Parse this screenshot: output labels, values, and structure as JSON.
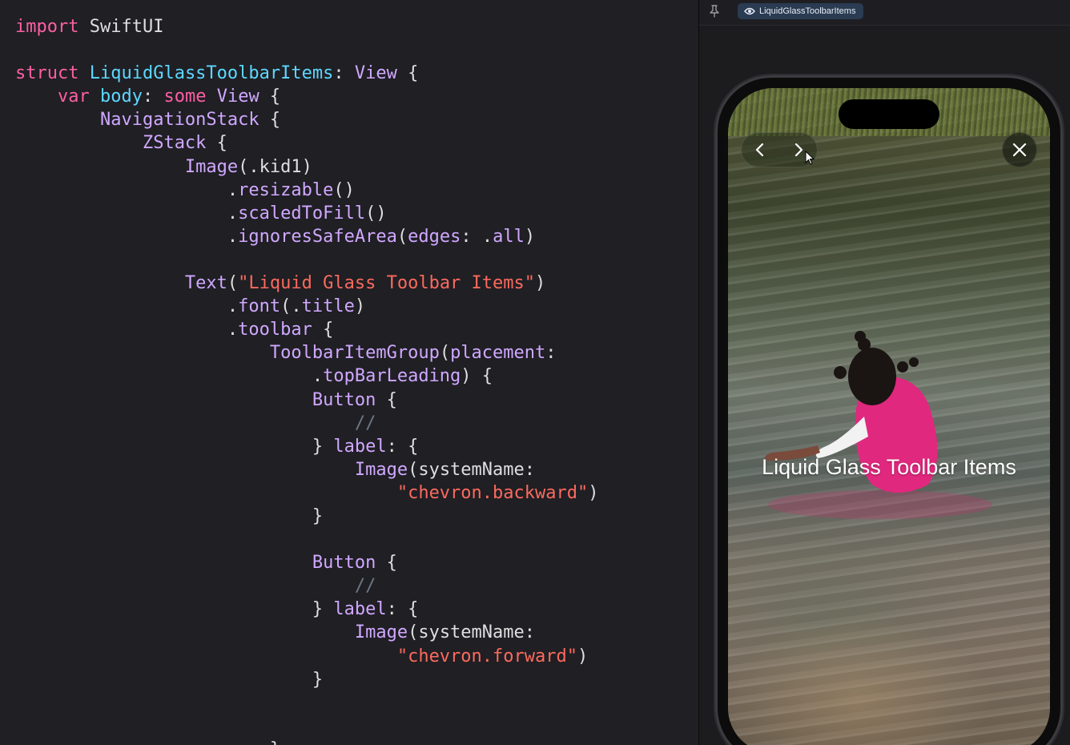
{
  "editor": {
    "lines": [
      [
        {
          "t": "import",
          "c": "kw"
        },
        {
          "t": " SwiftUI",
          "c": "pln"
        }
      ],
      [],
      [
        {
          "t": "struct",
          "c": "kw"
        },
        {
          "t": " ",
          "c": "pln"
        },
        {
          "t": "LiquidGlassToolbarItems",
          "c": "typ"
        },
        {
          "t": ": ",
          "c": "pln"
        },
        {
          "t": "View",
          "c": "cls"
        },
        {
          "t": " {",
          "c": "pln"
        }
      ],
      [
        {
          "t": "    ",
          "c": "pln"
        },
        {
          "t": "var",
          "c": "kw"
        },
        {
          "t": " ",
          "c": "pln"
        },
        {
          "t": "body",
          "c": "typ"
        },
        {
          "t": ": ",
          "c": "pln"
        },
        {
          "t": "some",
          "c": "kw"
        },
        {
          "t": " ",
          "c": "pln"
        },
        {
          "t": "View",
          "c": "cls"
        },
        {
          "t": " {",
          "c": "pln"
        }
      ],
      [
        {
          "t": "        ",
          "c": "pln"
        },
        {
          "t": "NavigationStack",
          "c": "cls"
        },
        {
          "t": " {",
          "c": "pln"
        }
      ],
      [
        {
          "t": "            ",
          "c": "pln"
        },
        {
          "t": "ZStack",
          "c": "cls"
        },
        {
          "t": " {",
          "c": "pln"
        }
      ],
      [
        {
          "t": "                ",
          "c": "pln"
        },
        {
          "t": "Image",
          "c": "cls"
        },
        {
          "t": "(.kid1)",
          "c": "pln"
        }
      ],
      [
        {
          "t": "                    .",
          "c": "pln"
        },
        {
          "t": "resizable",
          "c": "fn"
        },
        {
          "t": "()",
          "c": "pln"
        }
      ],
      [
        {
          "t": "                    .",
          "c": "pln"
        },
        {
          "t": "scaledToFill",
          "c": "fn"
        },
        {
          "t": "()",
          "c": "pln"
        }
      ],
      [
        {
          "t": "                    .",
          "c": "pln"
        },
        {
          "t": "ignoresSafeArea",
          "c": "fn"
        },
        {
          "t": "(",
          "c": "pln"
        },
        {
          "t": "edges",
          "c": "fn"
        },
        {
          "t": ": .",
          "c": "pln"
        },
        {
          "t": "all",
          "c": "fn"
        },
        {
          "t": ")",
          "c": "pln"
        }
      ],
      [],
      [
        {
          "t": "                ",
          "c": "pln"
        },
        {
          "t": "Text",
          "c": "cls"
        },
        {
          "t": "(",
          "c": "pln"
        },
        {
          "t": "\"Liquid Glass Toolbar Items\"",
          "c": "str"
        },
        {
          "t": ")",
          "c": "pln"
        }
      ],
      [
        {
          "t": "                    .",
          "c": "pln"
        },
        {
          "t": "font",
          "c": "fn"
        },
        {
          "t": "(.",
          "c": "pln"
        },
        {
          "t": "title",
          "c": "fn"
        },
        {
          "t": ")",
          "c": "pln"
        }
      ],
      [
        {
          "t": "                    .",
          "c": "pln"
        },
        {
          "t": "toolbar",
          "c": "fn"
        },
        {
          "t": " {",
          "c": "pln"
        }
      ],
      [
        {
          "t": "                        ",
          "c": "pln"
        },
        {
          "t": "ToolbarItemGroup",
          "c": "cls"
        },
        {
          "t": "(",
          "c": "pln"
        },
        {
          "t": "placement",
          "c": "fn"
        },
        {
          "t": ":",
          "c": "pln"
        }
      ],
      [
        {
          "t": "                            .",
          "c": "pln"
        },
        {
          "t": "topBarLeading",
          "c": "fn"
        },
        {
          "t": ") {",
          "c": "pln"
        }
      ],
      [
        {
          "t": "                            ",
          "c": "pln"
        },
        {
          "t": "Button",
          "c": "cls"
        },
        {
          "t": " {",
          "c": "pln"
        }
      ],
      [
        {
          "t": "                                ",
          "c": "pln"
        },
        {
          "t": "//",
          "c": "cmt"
        }
      ],
      [
        {
          "t": "                            } ",
          "c": "pln"
        },
        {
          "t": "label",
          "c": "fn"
        },
        {
          "t": ": {",
          "c": "pln"
        }
      ],
      [
        {
          "t": "                                ",
          "c": "pln"
        },
        {
          "t": "Image",
          "c": "cls"
        },
        {
          "t": "(systemName:",
          "c": "pln"
        }
      ],
      [
        {
          "t": "                                    ",
          "c": "pln"
        },
        {
          "t": "\"chevron.backward\"",
          "c": "str"
        },
        {
          "t": ")",
          "c": "pln"
        }
      ],
      [
        {
          "t": "                            }",
          "c": "pln"
        }
      ],
      [],
      [
        {
          "t": "                            ",
          "c": "pln"
        },
        {
          "t": "Button",
          "c": "cls"
        },
        {
          "t": " {",
          "c": "pln"
        }
      ],
      [
        {
          "t": "                                ",
          "c": "pln"
        },
        {
          "t": "//",
          "c": "cmt"
        }
      ],
      [
        {
          "t": "                            } ",
          "c": "pln"
        },
        {
          "t": "label",
          "c": "fn"
        },
        {
          "t": ": {",
          "c": "pln"
        }
      ],
      [
        {
          "t": "                                ",
          "c": "pln"
        },
        {
          "t": "Image",
          "c": "cls"
        },
        {
          "t": "(systemName:",
          "c": "pln"
        }
      ],
      [
        {
          "t": "                                    ",
          "c": "pln"
        },
        {
          "t": "\"chevron.forward\"",
          "c": "str"
        },
        {
          "t": ")",
          "c": "pln"
        }
      ],
      [
        {
          "t": "                            }",
          "c": "pln"
        }
      ],
      [],
      [],
      [
        {
          "t": "                        }",
          "c": "pln"
        }
      ]
    ]
  },
  "preview": {
    "scheme_label": "LiquidGlassToolbarItems",
    "screen_title": "Liquid Glass Toolbar Items",
    "icons": {
      "pin": "pin-icon",
      "eye": "eye-icon",
      "back": "chevron-backward-icon",
      "forward": "chevron-forward-icon",
      "close": "close-icon",
      "cursor": "mouse-cursor-icon"
    }
  },
  "colors": {
    "editor_bg": "#1f1f24",
    "keyword": "#fc5fa3",
    "type": "#5dd8ff",
    "function": "#d0a8ff",
    "string": "#fc6a5d",
    "comment": "#6c7986",
    "scheme_chip": "#2a3b52"
  }
}
